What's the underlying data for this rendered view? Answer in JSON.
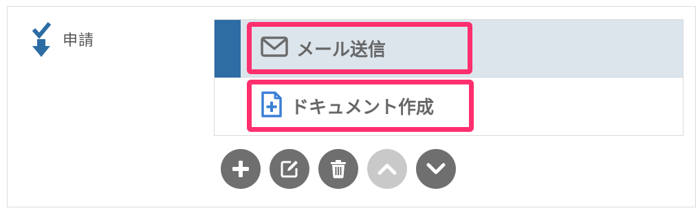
{
  "section": {
    "label": "申請",
    "icon": "check-arrow-down-icon",
    "accent_color": "#2e6ca4"
  },
  "items": [
    {
      "label": "メール送信",
      "icon": "mail-icon",
      "selected": true
    },
    {
      "label": "ドキュメント作成",
      "icon": "document-add-icon",
      "selected": false
    }
  ],
  "highlight_color": "#ff2f6e",
  "toolbar": [
    {
      "name": "add",
      "icon": "plus-icon",
      "enabled": true
    },
    {
      "name": "edit",
      "icon": "edit-icon",
      "enabled": true
    },
    {
      "name": "delete",
      "icon": "trash-icon",
      "enabled": true
    },
    {
      "name": "move-up",
      "icon": "chevron-up-icon",
      "enabled": false
    },
    {
      "name": "move-down",
      "icon": "chevron-down-icon",
      "enabled": true
    }
  ]
}
